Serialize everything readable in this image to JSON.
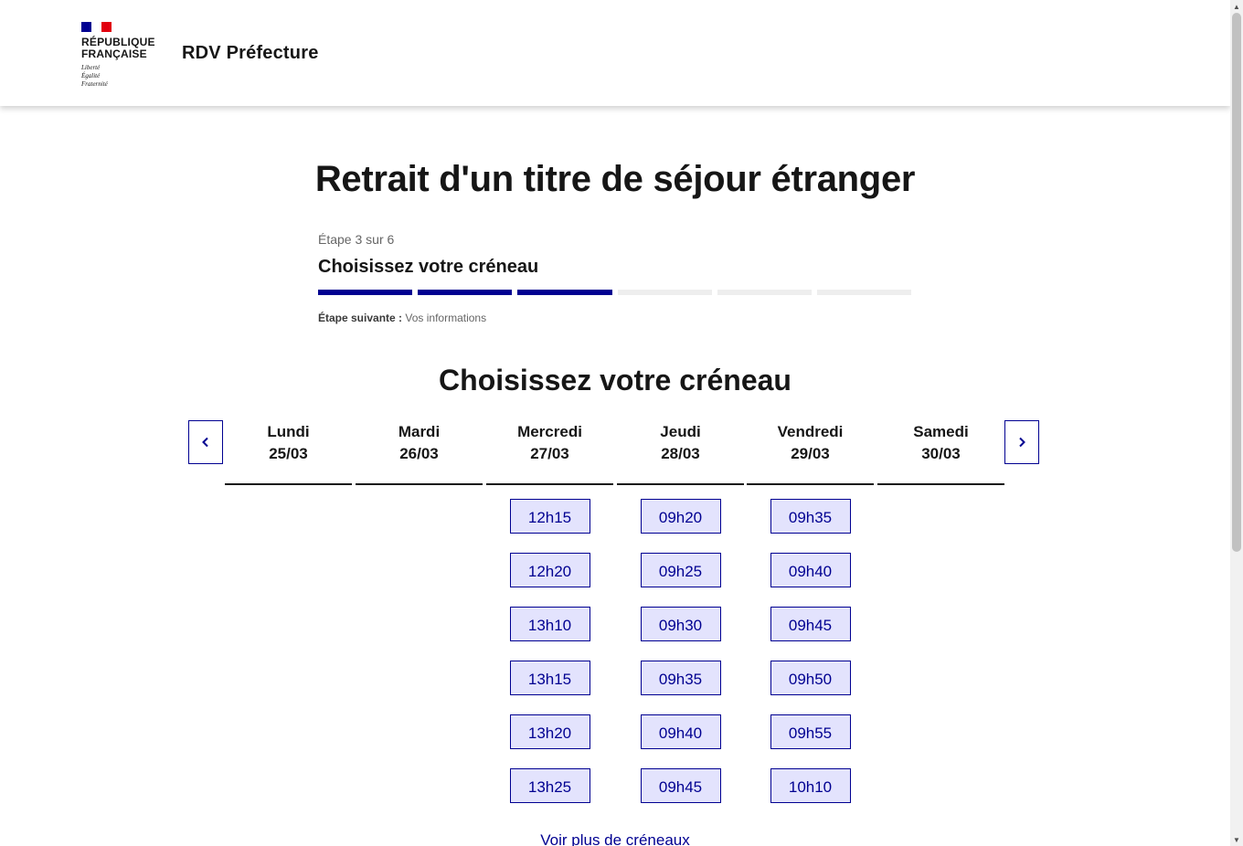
{
  "header": {
    "logo_line1": "RÉPUBLIQUE",
    "logo_line2": "FRANÇAISE",
    "motto": [
      "Liberté",
      "Égalité",
      "Fraternité"
    ],
    "service_title": "RDV Préfecture",
    "flag_colors": [
      "#000091",
      "#ffffff",
      "#e1000f"
    ]
  },
  "main": {
    "title": "Retrait d'un titre de séjour étranger"
  },
  "stepper": {
    "step_count": "Étape 3 sur 6",
    "step_title": "Choisissez votre créneau",
    "current_step": 3,
    "total_steps": 6,
    "active_color": "#000091",
    "inactive_color": "#eeeeee",
    "next_label": "Étape suivante :",
    "next_value": "Vos informations"
  },
  "slots_section": {
    "title": "Choisissez votre créneau",
    "prev_icon": "chevron-left-icon",
    "next_icon": "chevron-right-icon",
    "days": [
      {
        "name": "Lundi",
        "date": "25/03",
        "slots": []
      },
      {
        "name": "Mardi",
        "date": "26/03",
        "slots": []
      },
      {
        "name": "Mercredi",
        "date": "27/03",
        "slots": [
          "12h15",
          "12h20",
          "13h10",
          "13h15",
          "13h20",
          "13h25"
        ]
      },
      {
        "name": "Jeudi",
        "date": "28/03",
        "slots": [
          "09h20",
          "09h25",
          "09h30",
          "09h35",
          "09h40",
          "09h45"
        ]
      },
      {
        "name": "Vendredi",
        "date": "29/03",
        "slots": [
          "09h35",
          "09h40",
          "09h45",
          "09h50",
          "09h55",
          "10h10"
        ]
      },
      {
        "name": "Samedi",
        "date": "30/03",
        "slots": []
      }
    ],
    "more_link": "Voir plus de créneaux"
  }
}
